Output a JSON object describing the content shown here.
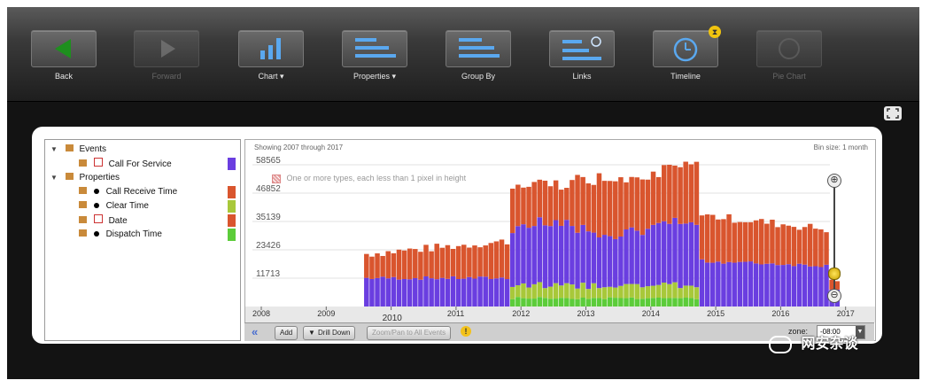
{
  "toolbar": {
    "buttons": [
      {
        "label": "Back"
      },
      {
        "label": "Forward"
      },
      {
        "label": "Chart ▾"
      },
      {
        "label": "Properties ▾"
      },
      {
        "label": "Group By"
      },
      {
        "label": "Links"
      },
      {
        "label": "Timeline"
      },
      {
        "label": "Pie Chart"
      }
    ]
  },
  "tree": {
    "events_label": "Events",
    "call_for_service": "Call For Service",
    "properties_label": "Properties",
    "call_receive_time": "Call Receive Time",
    "clear_time": "Clear Time",
    "date": "Date",
    "dispatch_time": "Dispatch Time"
  },
  "colors": {
    "call_for_service": "#6a3ee0",
    "call_receive_time": "#d9552e",
    "clear_time": "#a8c83a",
    "date": "#d9552e",
    "dispatch_time": "#5ccc3a"
  },
  "chart": {
    "showing": "Showing 2007 through 2017",
    "bin_size": "Bin size: 1 month",
    "warning": "One or more types, each less than 1 pixel in height"
  },
  "controls": {
    "add": "Add",
    "drill_down": "Drill Down",
    "zoom_all": "Zoom/Pan to All Events",
    "timezone_label": "zone:",
    "timezone_value": "-08:00"
  },
  "watermark": "网安杂谈",
  "chart_data": {
    "type": "bar",
    "stacked": true,
    "x_unit": "month",
    "x_range": [
      "2008",
      "2017"
    ],
    "ylim": [
      0,
      58565
    ],
    "yticks": [
      11713,
      23426,
      35139,
      46852,
      58565
    ],
    "xticks": [
      "2008",
      "2009",
      "2010",
      "2011",
      "2012",
      "2013",
      "2014",
      "2015",
      "2016",
      "2017"
    ],
    "series": [
      {
        "name": "Call For Service",
        "color": "#6a3ee0"
      },
      {
        "name": "Call Receive Time",
        "color": "#d9552e"
      },
      {
        "name": "Clear Time",
        "color": "#a8c83a"
      },
      {
        "name": "Date",
        "color": "#d9552e"
      },
      {
        "name": "Dispatch Time",
        "color": "#5ccc3a"
      }
    ],
    "period_totals": [
      {
        "period": "2009-08 to 2011-10",
        "total": 24000,
        "call_for_service": 11700
      },
      {
        "period": "2011-11 to 2014-09",
        "total": 52000,
        "call_for_service": 24500,
        "clear_time": 6500,
        "dispatch_time": 3500
      },
      {
        "period": "2014-10 to 2016-11",
        "total": 34000,
        "call_for_service": 17500
      }
    ]
  }
}
